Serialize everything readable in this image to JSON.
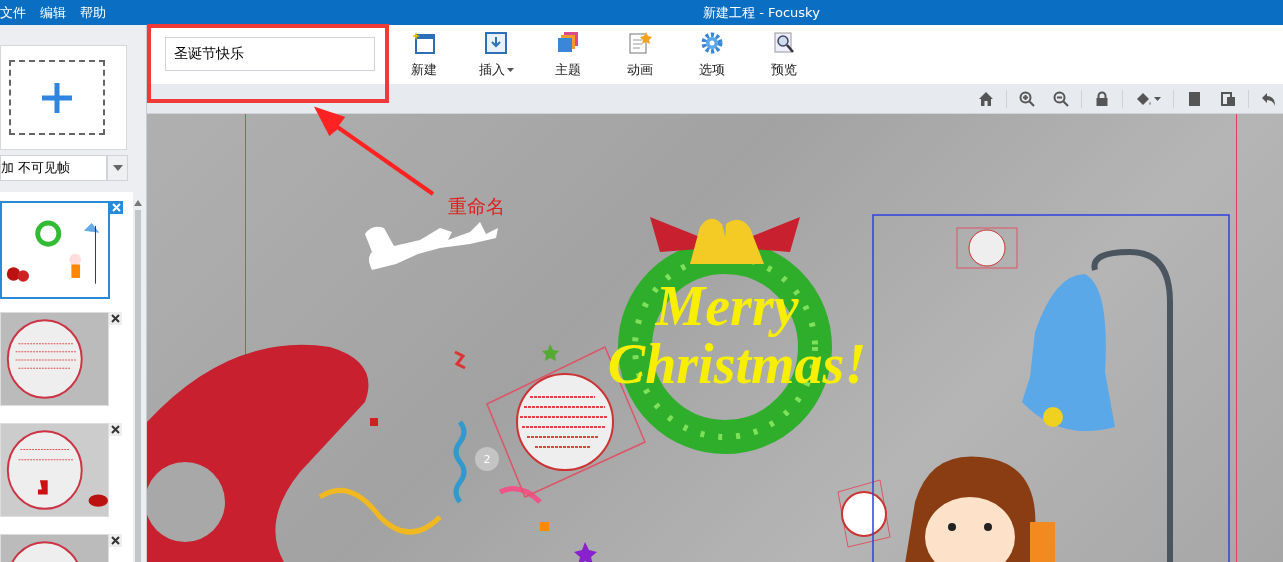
{
  "window": {
    "title": "新建工程 - Focusky"
  },
  "menu": [
    {
      "label": "文件"
    },
    {
      "label": "编辑"
    },
    {
      "label": "帮助"
    }
  ],
  "sidebar": {
    "dropdown": {
      "value": "加 不可见帧"
    },
    "frames": [
      {
        "kind": "scene",
        "selected": true
      },
      {
        "kind": "circle-text",
        "selected": false
      },
      {
        "kind": "circle-stocking",
        "selected": false
      },
      {
        "kind": "circle-text",
        "selected": false
      }
    ]
  },
  "name_field": {
    "value": "圣诞节快乐"
  },
  "toolbar": [
    {
      "kind": "new",
      "label": "新建",
      "has_menu": false
    },
    {
      "kind": "insert",
      "label": "插入",
      "has_menu": true
    },
    {
      "kind": "theme",
      "label": "主题",
      "has_menu": false
    },
    {
      "kind": "animation",
      "label": "动画",
      "has_menu": false
    },
    {
      "kind": "options",
      "label": "选项",
      "has_menu": false
    },
    {
      "kind": "preview",
      "label": "预览",
      "has_menu": false
    }
  ],
  "view_tools": [
    {
      "kind": "home",
      "has_menu": false
    },
    {
      "kind": "zoom-in",
      "has_menu": false
    },
    {
      "kind": "zoom-out",
      "has_menu": false
    },
    {
      "kind": "lock",
      "has_menu": false
    },
    {
      "kind": "fill",
      "has_menu": true
    },
    {
      "kind": "page",
      "has_menu": false
    },
    {
      "kind": "paste",
      "has_menu": false
    },
    {
      "kind": "undo",
      "has_menu": false
    }
  ],
  "canvas": {
    "headline": [
      "Merry",
      "Christmas!"
    ],
    "badge": "2"
  },
  "annotation": {
    "label": "重命名"
  }
}
